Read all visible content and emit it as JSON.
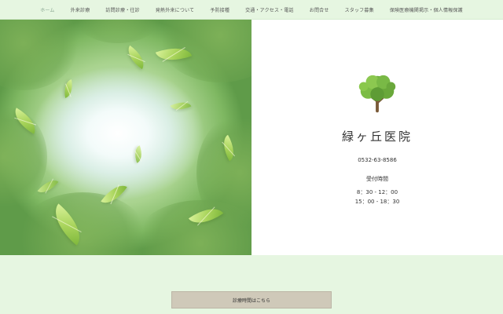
{
  "nav": {
    "items": [
      {
        "label": "ホーム",
        "active": true
      },
      {
        "label": "外来診療",
        "active": false
      },
      {
        "label": "訪問診療・往診",
        "active": false
      },
      {
        "label": "発熱外来について",
        "active": false
      },
      {
        "label": "予防接種",
        "active": false
      },
      {
        "label": "交通・アクセス・電話",
        "active": false
      },
      {
        "label": "お問合せ",
        "active": false
      },
      {
        "label": "スタッフ募集",
        "active": false
      },
      {
        "label": "保険医療機関掲示・個人情報保護",
        "active": false
      }
    ]
  },
  "clinic": {
    "name": "緑ヶ丘医院",
    "phone": "0532-63-8586",
    "hours_title": "受付時間",
    "hours": [
      "8：30 - 12：00",
      "15：00 - 18：30"
    ]
  },
  "cta": {
    "label": "診療時間はこちら"
  },
  "colors": {
    "background": "#e6f6e1",
    "nav_active": "#8ba892",
    "button": "#cfc9b9"
  }
}
